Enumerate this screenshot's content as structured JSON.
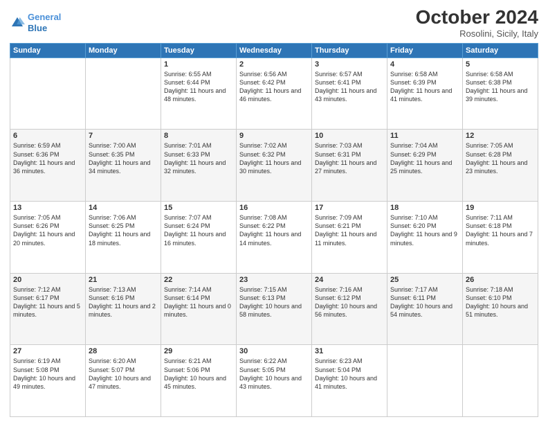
{
  "logo": {
    "line1": "General",
    "line2": "Blue"
  },
  "title": "October 2024",
  "subtitle": "Rosolini, Sicily, Italy",
  "headers": [
    "Sunday",
    "Monday",
    "Tuesday",
    "Wednesday",
    "Thursday",
    "Friday",
    "Saturday"
  ],
  "weeks": [
    [
      {
        "day": "",
        "info": ""
      },
      {
        "day": "",
        "info": ""
      },
      {
        "day": "1",
        "info": "Sunrise: 6:55 AM\nSunset: 6:44 PM\nDaylight: 11 hours and 48 minutes."
      },
      {
        "day": "2",
        "info": "Sunrise: 6:56 AM\nSunset: 6:42 PM\nDaylight: 11 hours and 46 minutes."
      },
      {
        "day": "3",
        "info": "Sunrise: 6:57 AM\nSunset: 6:41 PM\nDaylight: 11 hours and 43 minutes."
      },
      {
        "day": "4",
        "info": "Sunrise: 6:58 AM\nSunset: 6:39 PM\nDaylight: 11 hours and 41 minutes."
      },
      {
        "day": "5",
        "info": "Sunrise: 6:58 AM\nSunset: 6:38 PM\nDaylight: 11 hours and 39 minutes."
      }
    ],
    [
      {
        "day": "6",
        "info": "Sunrise: 6:59 AM\nSunset: 6:36 PM\nDaylight: 11 hours and 36 minutes."
      },
      {
        "day": "7",
        "info": "Sunrise: 7:00 AM\nSunset: 6:35 PM\nDaylight: 11 hours and 34 minutes."
      },
      {
        "day": "8",
        "info": "Sunrise: 7:01 AM\nSunset: 6:33 PM\nDaylight: 11 hours and 32 minutes."
      },
      {
        "day": "9",
        "info": "Sunrise: 7:02 AM\nSunset: 6:32 PM\nDaylight: 11 hours and 30 minutes."
      },
      {
        "day": "10",
        "info": "Sunrise: 7:03 AM\nSunset: 6:31 PM\nDaylight: 11 hours and 27 minutes."
      },
      {
        "day": "11",
        "info": "Sunrise: 7:04 AM\nSunset: 6:29 PM\nDaylight: 11 hours and 25 minutes."
      },
      {
        "day": "12",
        "info": "Sunrise: 7:05 AM\nSunset: 6:28 PM\nDaylight: 11 hours and 23 minutes."
      }
    ],
    [
      {
        "day": "13",
        "info": "Sunrise: 7:05 AM\nSunset: 6:26 PM\nDaylight: 11 hours and 20 minutes."
      },
      {
        "day": "14",
        "info": "Sunrise: 7:06 AM\nSunset: 6:25 PM\nDaylight: 11 hours and 18 minutes."
      },
      {
        "day": "15",
        "info": "Sunrise: 7:07 AM\nSunset: 6:24 PM\nDaylight: 11 hours and 16 minutes."
      },
      {
        "day": "16",
        "info": "Sunrise: 7:08 AM\nSunset: 6:22 PM\nDaylight: 11 hours and 14 minutes."
      },
      {
        "day": "17",
        "info": "Sunrise: 7:09 AM\nSunset: 6:21 PM\nDaylight: 11 hours and 11 minutes."
      },
      {
        "day": "18",
        "info": "Sunrise: 7:10 AM\nSunset: 6:20 PM\nDaylight: 11 hours and 9 minutes."
      },
      {
        "day": "19",
        "info": "Sunrise: 7:11 AM\nSunset: 6:18 PM\nDaylight: 11 hours and 7 minutes."
      }
    ],
    [
      {
        "day": "20",
        "info": "Sunrise: 7:12 AM\nSunset: 6:17 PM\nDaylight: 11 hours and 5 minutes."
      },
      {
        "day": "21",
        "info": "Sunrise: 7:13 AM\nSunset: 6:16 PM\nDaylight: 11 hours and 2 minutes."
      },
      {
        "day": "22",
        "info": "Sunrise: 7:14 AM\nSunset: 6:14 PM\nDaylight: 11 hours and 0 minutes."
      },
      {
        "day": "23",
        "info": "Sunrise: 7:15 AM\nSunset: 6:13 PM\nDaylight: 10 hours and 58 minutes."
      },
      {
        "day": "24",
        "info": "Sunrise: 7:16 AM\nSunset: 6:12 PM\nDaylight: 10 hours and 56 minutes."
      },
      {
        "day": "25",
        "info": "Sunrise: 7:17 AM\nSunset: 6:11 PM\nDaylight: 10 hours and 54 minutes."
      },
      {
        "day": "26",
        "info": "Sunrise: 7:18 AM\nSunset: 6:10 PM\nDaylight: 10 hours and 51 minutes."
      }
    ],
    [
      {
        "day": "27",
        "info": "Sunrise: 6:19 AM\nSunset: 5:08 PM\nDaylight: 10 hours and 49 minutes."
      },
      {
        "day": "28",
        "info": "Sunrise: 6:20 AM\nSunset: 5:07 PM\nDaylight: 10 hours and 47 minutes."
      },
      {
        "day": "29",
        "info": "Sunrise: 6:21 AM\nSunset: 5:06 PM\nDaylight: 10 hours and 45 minutes."
      },
      {
        "day": "30",
        "info": "Sunrise: 6:22 AM\nSunset: 5:05 PM\nDaylight: 10 hours and 43 minutes."
      },
      {
        "day": "31",
        "info": "Sunrise: 6:23 AM\nSunset: 5:04 PM\nDaylight: 10 hours and 41 minutes."
      },
      {
        "day": "",
        "info": ""
      },
      {
        "day": "",
        "info": ""
      }
    ]
  ]
}
